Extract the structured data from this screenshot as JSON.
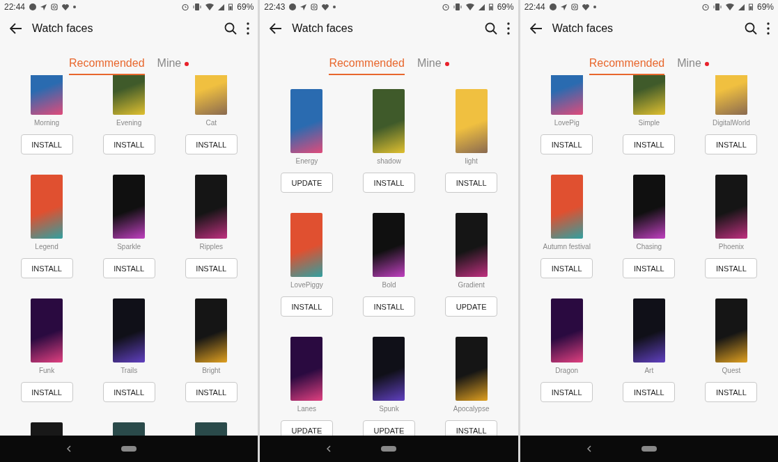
{
  "screens": [
    {
      "status_bar": {
        "time": "22:44",
        "battery": "69%"
      },
      "title": "Watch faces",
      "tabs": [
        {
          "label": "Recommended",
          "selected": true,
          "dot": false
        },
        {
          "label": "Mine",
          "selected": false,
          "dot": true
        }
      ],
      "faces": [
        {
          "kind": "clipped",
          "name": "Morning",
          "button": "INSTALL"
        },
        {
          "kind": "clipped",
          "name": "Evening",
          "button": "INSTALL"
        },
        {
          "kind": "clipped",
          "name": "Cat",
          "button": "INSTALL"
        },
        {
          "kind": "full",
          "name": "Legend",
          "button": "INSTALL"
        },
        {
          "kind": "full",
          "name": "Sparkle",
          "button": "INSTALL"
        },
        {
          "kind": "full",
          "name": "Ripples",
          "button": "INSTALL"
        },
        {
          "kind": "full",
          "name": "Funk",
          "button": "INSTALL"
        },
        {
          "kind": "full",
          "name": "Trails",
          "button": "INSTALL"
        },
        {
          "kind": "full",
          "name": "Bright",
          "button": "INSTALL"
        },
        {
          "kind": "peek"
        },
        {
          "kind": "peek"
        },
        {
          "kind": "peek"
        }
      ]
    },
    {
      "status_bar": {
        "time": "22:43",
        "battery": "69%"
      },
      "title": "Watch faces",
      "tabs": [
        {
          "label": "Recommended",
          "selected": true,
          "dot": false
        },
        {
          "label": "Mine",
          "selected": false,
          "dot": true
        }
      ],
      "faces": [
        {
          "kind": "full",
          "name": "Energy",
          "button": "UPDATE"
        },
        {
          "kind": "full",
          "name": "shadow",
          "button": "INSTALL"
        },
        {
          "kind": "full",
          "name": "light",
          "button": "INSTALL"
        },
        {
          "kind": "full",
          "name": "LovePiggy",
          "button": "INSTALL"
        },
        {
          "kind": "full",
          "name": "Bold",
          "button": "INSTALL"
        },
        {
          "kind": "full",
          "name": "Gradient",
          "button": "UPDATE"
        },
        {
          "kind": "full",
          "name": "Lanes",
          "button": "UPDATE"
        },
        {
          "kind": "full",
          "name": "Spunk",
          "button": "UPDATE"
        },
        {
          "kind": "full",
          "name": "Apocalypse",
          "button": "INSTALL"
        }
      ]
    },
    {
      "status_bar": {
        "time": "22:44",
        "battery": "69%"
      },
      "title": "Watch faces",
      "tabs": [
        {
          "label": "Recommended",
          "selected": true,
          "dot": false
        },
        {
          "label": "Mine",
          "selected": false,
          "dot": true
        }
      ],
      "faces": [
        {
          "kind": "clipped",
          "name": "LovePig",
          "button": "INSTALL"
        },
        {
          "kind": "clipped",
          "name": "Simple",
          "button": "INSTALL"
        },
        {
          "kind": "clipped",
          "name": "DigitalWorld",
          "button": "INSTALL"
        },
        {
          "kind": "full",
          "name": "Autumn festival",
          "button": "INSTALL"
        },
        {
          "kind": "full",
          "name": "Chasing",
          "button": "INSTALL"
        },
        {
          "kind": "full",
          "name": "Phoenix",
          "button": "INSTALL"
        },
        {
          "kind": "full",
          "name": "Dragon",
          "button": "INSTALL"
        },
        {
          "kind": "full",
          "name": "Art",
          "button": "INSTALL"
        },
        {
          "kind": "full",
          "name": "Quest",
          "button": "INSTALL"
        }
      ]
    }
  ]
}
